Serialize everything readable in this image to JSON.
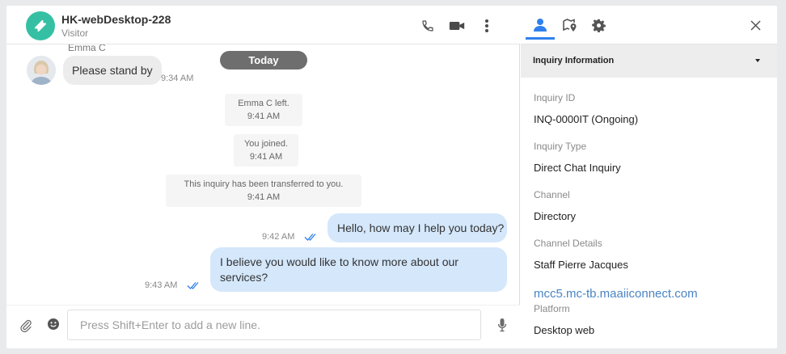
{
  "header": {
    "title": "HK-webDesktop-228",
    "subtitle": "Visitor"
  },
  "messages": {
    "agent_name": "Emma C",
    "today_label": "Today",
    "incoming": {
      "text": "Please stand by",
      "time": "9:34 AM"
    },
    "system": [
      {
        "line1": "Emma C left.",
        "line2": "9:41 AM"
      },
      {
        "line1": "You joined.",
        "line2": "9:41 AM"
      },
      {
        "line1": "This inquiry has been transferred to you.",
        "line2": "9:41 AM"
      }
    ],
    "outgoing": [
      {
        "text": "Hello, how may I help you today?",
        "time": "9:42 AM"
      },
      {
        "text": "I believe you would like to know more about our services?",
        "time": "9:43 AM"
      }
    ]
  },
  "composer": {
    "placeholder": "Press Shift+Enter to add a new line."
  },
  "panel": {
    "section_title": "Inquiry Information",
    "fields": [
      {
        "label": "Inquiry ID",
        "value": "INQ-0000IT (Ongoing)"
      },
      {
        "label": "Inquiry Type",
        "value": "Direct Chat Inquiry"
      },
      {
        "label": "Channel",
        "value": "Directory"
      },
      {
        "label": "Channel Details",
        "value": "Staff Pierre Jacques"
      }
    ],
    "link": "mcc5.mc-tb.maaiiconnect.com",
    "platform_label": "Platform",
    "platform_value": "Desktop web"
  },
  "icons": {
    "header": [
      "phone-icon",
      "video-icon",
      "more-vertical-icon"
    ],
    "tabs": [
      "user-icon",
      "location-icon",
      "gear-icon"
    ],
    "composer": [
      "paperclip-icon",
      "emoji-icon",
      "microphone-icon"
    ]
  },
  "colors": {
    "accent": "#2f80ed",
    "avatar": "#35c0a4",
    "outgoing_bubble": "#d4e7fb",
    "incoming_bubble": "#ececec",
    "link": "#4a84c4"
  }
}
